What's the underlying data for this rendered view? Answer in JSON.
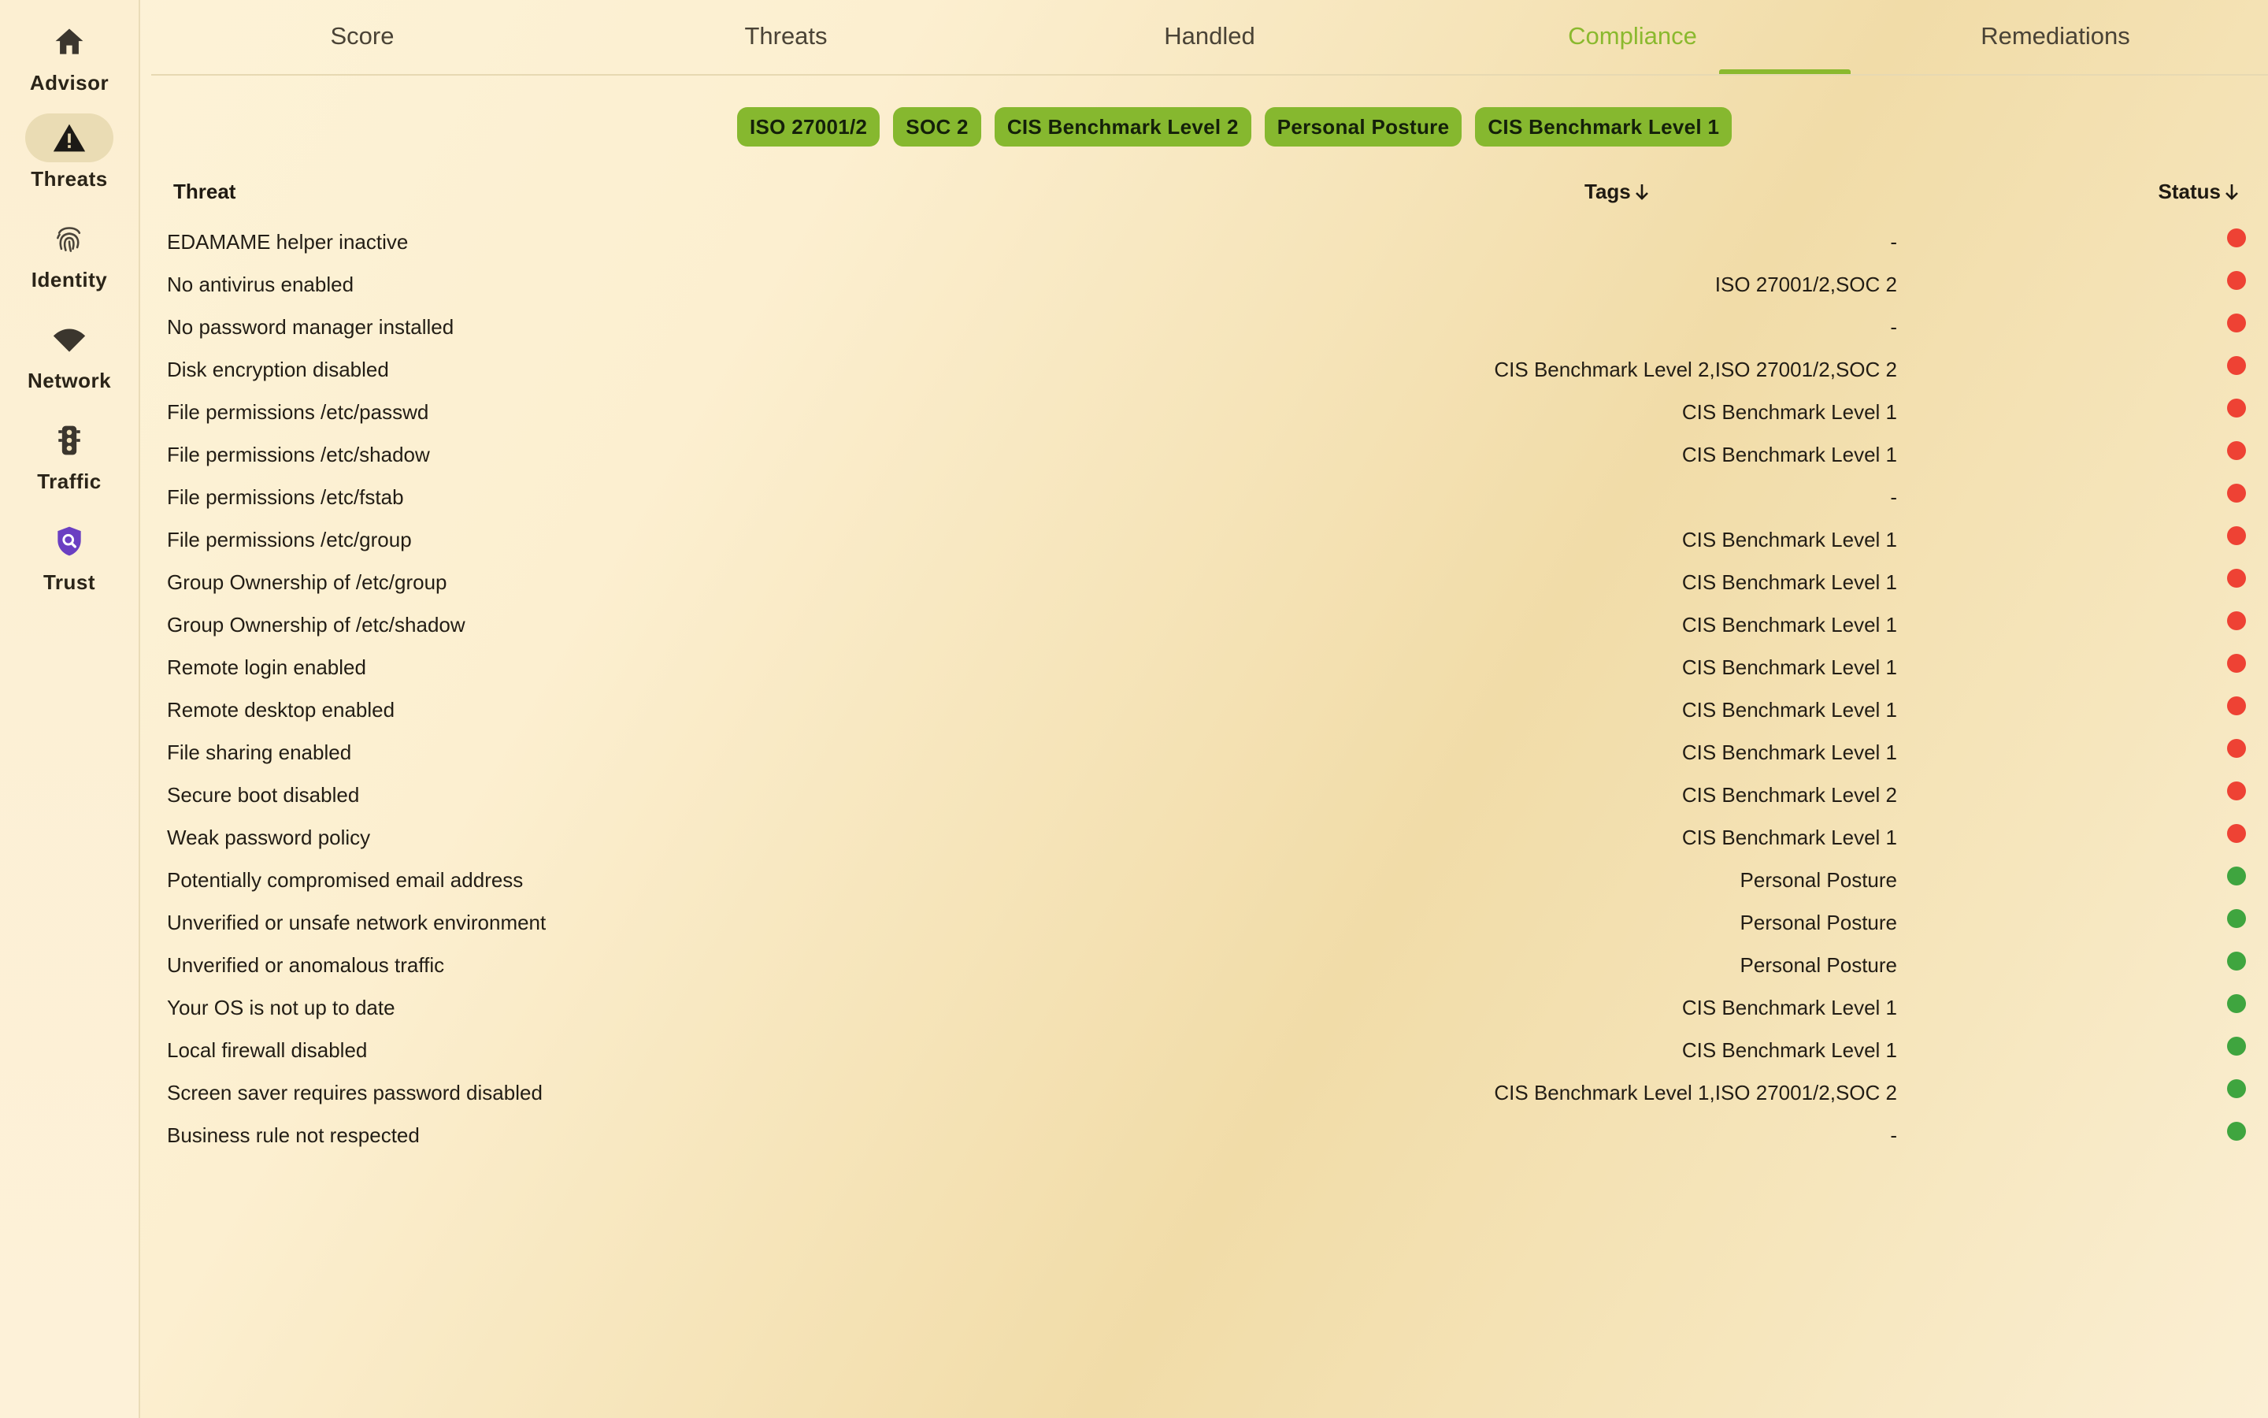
{
  "colors": {
    "accent": "#8ab92e",
    "chip_bg": "#86b82f",
    "status_red": "#ee4234",
    "status_green": "#3fa53f",
    "trust_icon": "#6a3fc2"
  },
  "sidebar": {
    "items": [
      {
        "label": "Advisor",
        "icon": "home-icon"
      },
      {
        "label": "Threats",
        "icon": "warning-triangle-icon"
      },
      {
        "label": "Identity",
        "icon": "fingerprint-icon"
      },
      {
        "label": "Network",
        "icon": "wifi-icon"
      },
      {
        "label": "Traffic",
        "icon": "traffic-light-icon"
      },
      {
        "label": "Trust",
        "icon": "shield-search-icon"
      }
    ],
    "active": "Threats"
  },
  "tabs": [
    {
      "label": "Score"
    },
    {
      "label": "Threats"
    },
    {
      "label": "Handled"
    },
    {
      "label": "Compliance"
    },
    {
      "label": "Remediations"
    }
  ],
  "active_tab": "Compliance",
  "filters": [
    {
      "label": "ISO 27001/2"
    },
    {
      "label": "SOC 2"
    },
    {
      "label": "CIS Benchmark Level 2"
    },
    {
      "label": "Personal Posture"
    },
    {
      "label": "CIS Benchmark Level 1"
    }
  ],
  "table": {
    "headers": {
      "threat": "Threat",
      "tags": "Tags",
      "status": "Status"
    },
    "rows": [
      {
        "threat": "EDAMAME helper inactive",
        "tags": "-",
        "status": "red"
      },
      {
        "threat": "No antivirus enabled",
        "tags": "ISO 27001/2,SOC 2",
        "status": "red"
      },
      {
        "threat": "No password manager installed",
        "tags": "-",
        "status": "red"
      },
      {
        "threat": "Disk encryption disabled",
        "tags": "CIS Benchmark Level 2,ISO 27001/2,SOC 2",
        "status": "red"
      },
      {
        "threat": "File permissions /etc/passwd",
        "tags": "CIS Benchmark Level 1",
        "status": "red"
      },
      {
        "threat": "File permissions /etc/shadow",
        "tags": "CIS Benchmark Level 1",
        "status": "red"
      },
      {
        "threat": "File permissions /etc/fstab",
        "tags": "-",
        "status": "red"
      },
      {
        "threat": "File permissions /etc/group",
        "tags": "CIS Benchmark Level 1",
        "status": "red"
      },
      {
        "threat": "Group Ownership of /etc/group",
        "tags": "CIS Benchmark Level 1",
        "status": "red"
      },
      {
        "threat": "Group Ownership of /etc/shadow",
        "tags": "CIS Benchmark Level 1",
        "status": "red"
      },
      {
        "threat": "Remote login enabled",
        "tags": "CIS Benchmark Level 1",
        "status": "red"
      },
      {
        "threat": "Remote desktop enabled",
        "tags": "CIS Benchmark Level 1",
        "status": "red"
      },
      {
        "threat": "File sharing enabled",
        "tags": "CIS Benchmark Level 1",
        "status": "red"
      },
      {
        "threat": "Secure boot disabled",
        "tags": "CIS Benchmark Level 2",
        "status": "red"
      },
      {
        "threat": "Weak password policy",
        "tags": "CIS Benchmark Level 1",
        "status": "red"
      },
      {
        "threat": "Potentially compromised email address",
        "tags": "Personal Posture",
        "status": "green"
      },
      {
        "threat": "Unverified or unsafe network environment",
        "tags": "Personal Posture",
        "status": "green"
      },
      {
        "threat": "Unverified or anomalous traffic",
        "tags": "Personal Posture",
        "status": "green"
      },
      {
        "threat": "Your OS is not up to date",
        "tags": "CIS Benchmark Level 1",
        "status": "green"
      },
      {
        "threat": "Local firewall disabled",
        "tags": "CIS Benchmark Level 1",
        "status": "green"
      },
      {
        "threat": "Screen saver requires password disabled",
        "tags": "CIS Benchmark Level 1,ISO 27001/2,SOC 2",
        "status": "green"
      },
      {
        "threat": "Business rule not respected",
        "tags": "-",
        "status": "green"
      }
    ]
  }
}
